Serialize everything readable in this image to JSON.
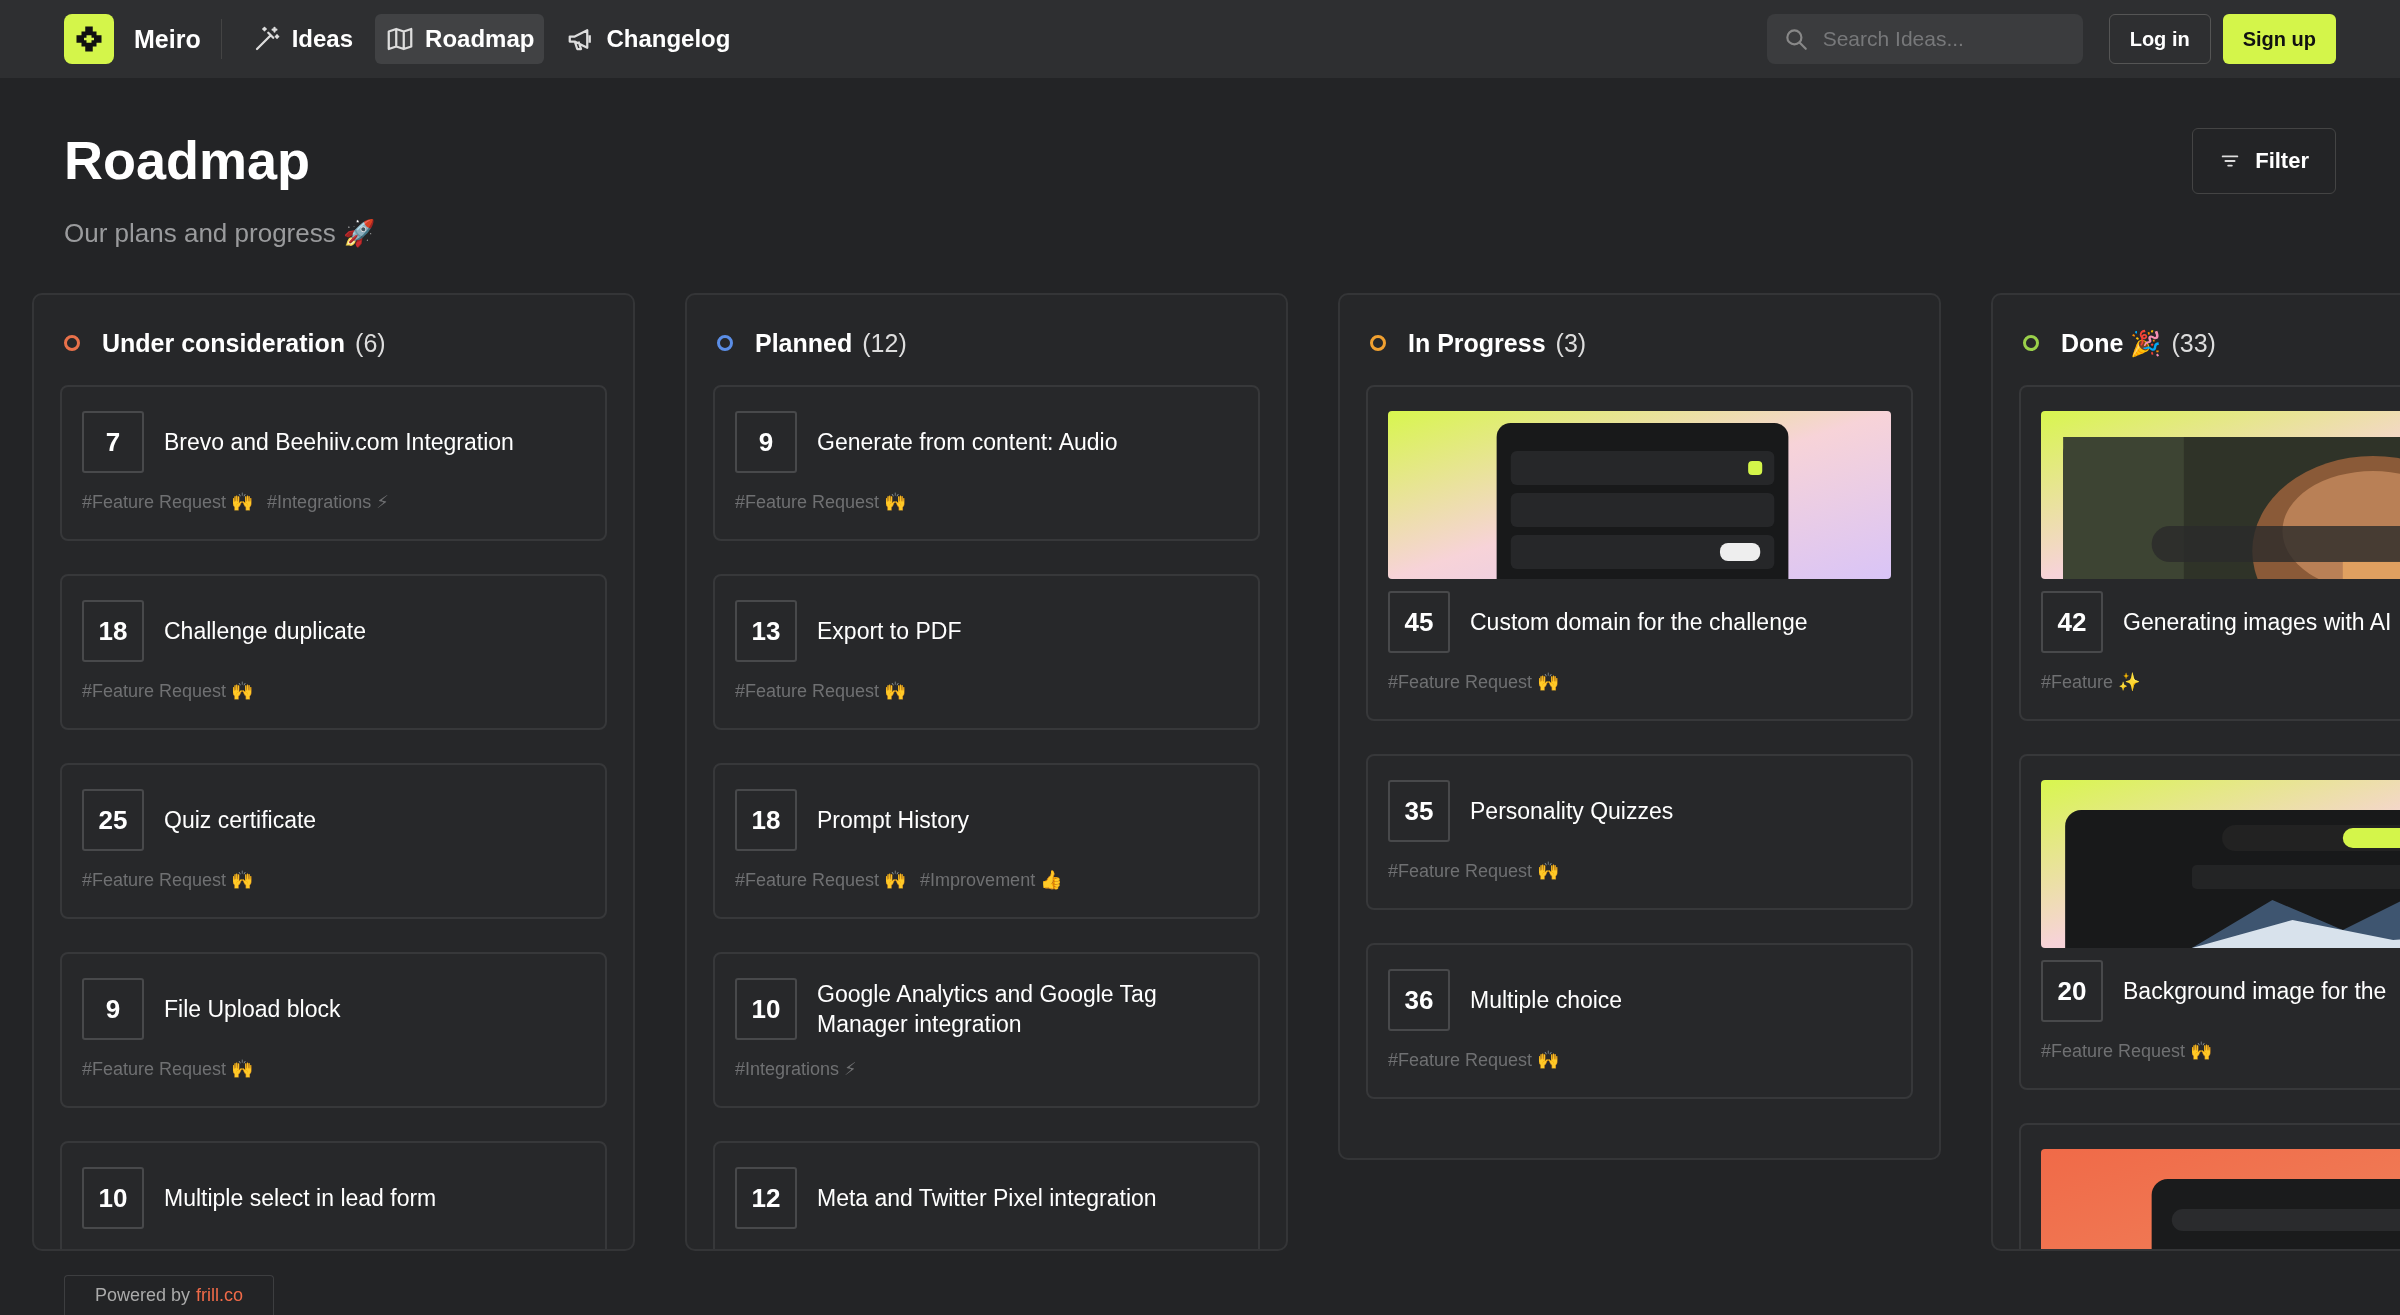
{
  "header": {
    "brand": "Meiro",
    "nav": [
      {
        "label": "Ideas",
        "selected": false
      },
      {
        "label": "Roadmap",
        "selected": true
      },
      {
        "label": "Changelog",
        "selected": false
      }
    ],
    "search": {
      "placeholder": "Search Ideas..."
    },
    "login": "Log in",
    "signup": "Sign up"
  },
  "page": {
    "title": "Roadmap",
    "subtitle": "Our plans and progress 🚀",
    "filter": "Filter"
  },
  "columns": [
    {
      "title": "Under consideration",
      "count": "(6)",
      "color": "#e8714a",
      "items": [
        {
          "kind": "plain",
          "votes": "7",
          "title": "Brevo and Beehiiv.com Integration",
          "tags": [
            "#Feature Request 🙌",
            "#Integrations ⚡"
          ]
        },
        {
          "kind": "plain",
          "votes": "18",
          "title": "Challenge duplicate",
          "tags": [
            "#Feature Request 🙌"
          ]
        },
        {
          "kind": "plain",
          "votes": "25",
          "title": "Quiz certificate",
          "tags": [
            "#Feature Request 🙌"
          ]
        },
        {
          "kind": "plain",
          "votes": "9",
          "title": "File Upload block",
          "tags": [
            "#Feature Request 🙌"
          ]
        },
        {
          "kind": "plain",
          "votes": "10",
          "title": "Multiple select in lead form"
        }
      ]
    },
    {
      "title": "Planned",
      "count": "(12)",
      "color": "#5b8ee6",
      "items": [
        {
          "kind": "plain",
          "votes": "9",
          "title": "Generate from content: Audio",
          "tags": [
            "#Feature Request 🙌"
          ]
        },
        {
          "kind": "plain",
          "votes": "13",
          "title": "Export to PDF",
          "tags": [
            "#Feature Request 🙌"
          ]
        },
        {
          "kind": "plain",
          "votes": "18",
          "title": "Prompt History",
          "tags": [
            "#Feature Request 🙌",
            "#Improvement 👍"
          ]
        },
        {
          "kind": "plain",
          "votes": "10",
          "title": "Google Analytics and Google Tag Manager integration",
          "tags": [
            "#Integrations ⚡"
          ]
        },
        {
          "kind": "plain",
          "votes": "12",
          "title": "Meta and Twitter Pixel integration"
        }
      ]
    },
    {
      "title": "In Progress",
      "count": "(3)",
      "color": "#f0a030",
      "items": [
        {
          "kind": "picture",
          "votes": "45",
          "title": "Custom domain for the challenge",
          "tags": [
            "#Feature Request 🙌"
          ]
        },
        {
          "kind": "plain",
          "votes": "35",
          "title": "Personality Quizzes",
          "tags": [
            "#Feature Request 🙌"
          ]
        },
        {
          "kind": "plain",
          "votes": "36",
          "title": "Multiple choice",
          "tags": [
            "#Feature Request 🙌"
          ]
        }
      ]
    },
    {
      "title": "Done 🎉",
      "count": "(33)",
      "color": "#9ad04a",
      "items": [
        {
          "kind": "picture",
          "votes": "42",
          "title": "Generating images with AI",
          "tags": [
            "#Feature ✨"
          ]
        },
        {
          "kind": "picture",
          "votes": "20",
          "title": "Background image for the",
          "tags": [
            "#Feature Request 🙌"
          ]
        },
        {
          "kind": "picture"
        }
      ]
    }
  ],
  "footer": {
    "prefix": "Powered by",
    "link": "frill.co"
  }
}
